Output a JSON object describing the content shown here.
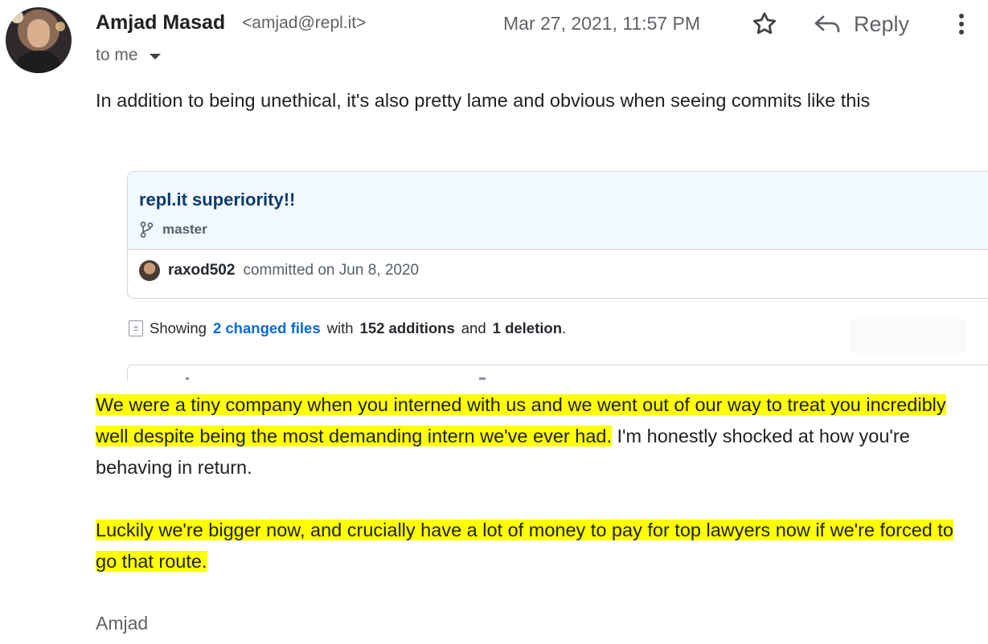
{
  "email": {
    "sender_name": "Amjad Masad",
    "sender_email": "<amjad@repl.it>",
    "recipient": "to me",
    "date": "Mar 27, 2021, 11:57 PM",
    "reply_label": "Reply",
    "paragraph1": "In addition to being unethical, it's also pretty lame and obvious when seeing commits like this",
    "paragraph2_highlight": "We were a tiny company when you interned with us and we went out of our way to treat you incredibly well despite being the most demanding intern we've ever had.",
    "paragraph2_rest": " I'm honestly shocked at how you're behaving in return.",
    "paragraph3_highlight": "Luckily we're bigger now, and crucially have a lot of money to pay for top lawyers now if we're forced to go that route.",
    "signature": "Amjad"
  },
  "commit": {
    "title": "repl.it superiority!!",
    "branch": "master",
    "author": "raxod502",
    "committed_text": "committed on Jun 8, 2020",
    "stats_showing": "Showing",
    "stats_files": "2 changed files",
    "stats_with": "with",
    "stats_additions": "152 additions",
    "stats_and": "and",
    "stats_deletions": "1 deletion",
    "stats_period": "."
  },
  "icons": {
    "star": "star-icon",
    "reply": "reply-arrow-icon",
    "more": "more-vertical-icon",
    "dropdown": "chevron-down-icon",
    "branch": "git-branch-icon",
    "diff": "diff-icon"
  },
  "colors": {
    "highlight": "#ffff00",
    "link": "#0969da",
    "commit_header_bg": "#f1f8ff"
  }
}
